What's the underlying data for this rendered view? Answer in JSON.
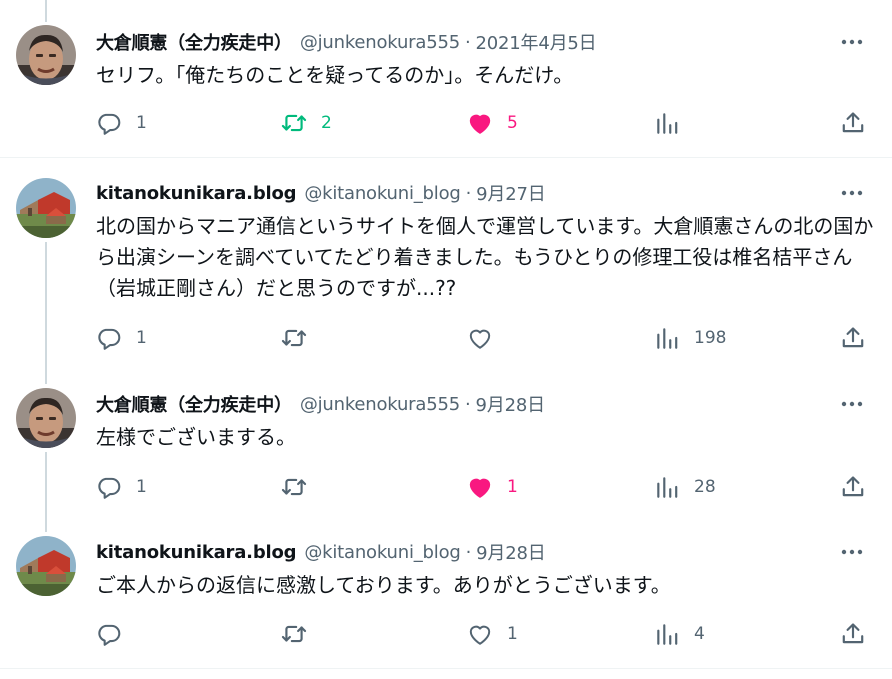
{
  "colors": {
    "text": "#0f1419",
    "muted": "#536471",
    "retweet_active": "#00ba7c",
    "like_active": "#f91880",
    "divider": "#eff3f4",
    "thread_line": "#cfd9de"
  },
  "icons": {
    "reply": "reply-icon",
    "retweet": "retweet-icon",
    "like": "heart-icon",
    "views": "analytics-icon",
    "share": "share-icon",
    "more": "more-icon"
  },
  "tweets": [
    {
      "name": "大倉順憲（全力疾走中）",
      "handle": "@junkenokura555",
      "dot": "·",
      "time": "2021年4月5日",
      "text": "セリフ。「俺たちのことを疑ってるのか」。そんだけ。",
      "reply_count": "1",
      "retweet_count": "2",
      "retweeted": true,
      "like_count": "5",
      "liked": true,
      "view_count": ""
    },
    {
      "name": "kitanokunikara.blog",
      "handle": "@kitanokuni_blog",
      "dot": "·",
      "time": "9月27日",
      "text": "北の国からマニア通信というサイトを個人で運営しています。大倉順憲さんの北の国から出演シーンを調べていてたどり着きました。もうひとりの修理工役は椎名桔平さん（岩城正剛さん）だと思うのですが...??",
      "reply_count": "1",
      "retweet_count": "",
      "retweeted": false,
      "like_count": "",
      "liked": false,
      "view_count": "198"
    },
    {
      "name": "大倉順憲（全力疾走中）",
      "handle": "@junkenokura555",
      "dot": "·",
      "time": "9月28日",
      "text": "左様でございまする。",
      "reply_count": "1",
      "retweet_count": "",
      "retweeted": false,
      "like_count": "1",
      "liked": true,
      "view_count": "28"
    },
    {
      "name": "kitanokunikara.blog",
      "handle": "@kitanokuni_blog",
      "dot": "·",
      "time": "9月28日",
      "text": "ご本人からの返信に感激しております。ありがとうございます。",
      "reply_count": "",
      "retweet_count": "",
      "retweeted": false,
      "like_count": "1",
      "liked": false,
      "view_count": "4"
    }
  ]
}
